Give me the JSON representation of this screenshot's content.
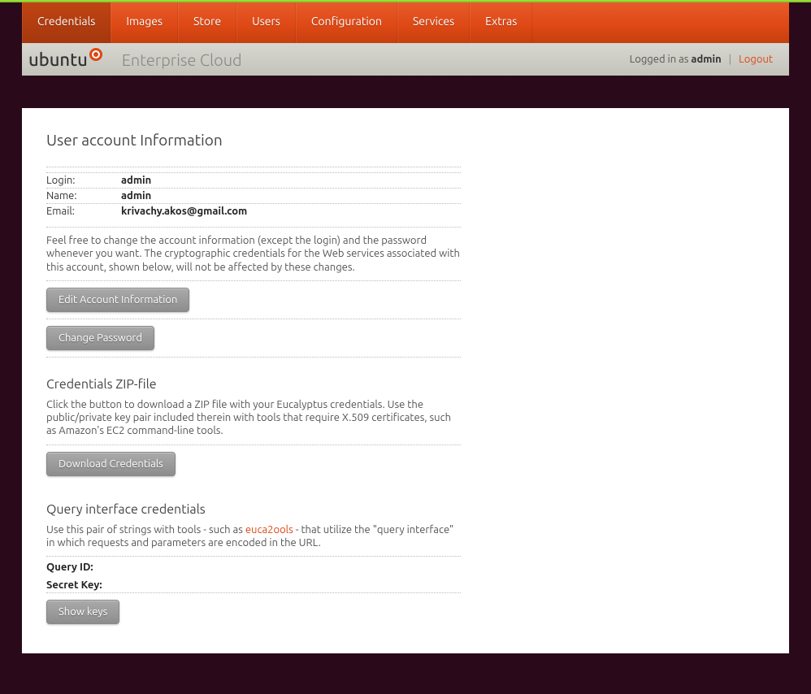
{
  "nav": {
    "items": [
      {
        "label": "Credentials",
        "active": true
      },
      {
        "label": "Images"
      },
      {
        "label": "Store"
      },
      {
        "label": "Users"
      },
      {
        "label": "Configuration"
      },
      {
        "label": "Services"
      },
      {
        "label": "Extras"
      }
    ]
  },
  "header": {
    "logo_text": "ubuntu",
    "subtitle": "Enterprise Cloud",
    "logged_in_prefix": "Logged in as ",
    "user": "admin",
    "logout": "Logout"
  },
  "account": {
    "title": "User account Information",
    "rows": {
      "login_label": "Login:",
      "login_value": "admin",
      "name_label": "Name:",
      "name_value": "admin",
      "email_label": "Email:",
      "email_value": "krivachy.akos@gmail.com"
    },
    "blurb": "Feel free to change the account information (except the login) and the password whenever you want. The cryptographic credentials for the Web services associated with this account, shown below, will not be affected by these changes.",
    "edit_btn": "Edit Account Information",
    "change_pw_btn": "Change Password"
  },
  "zip": {
    "title": "Credentials ZIP-file",
    "blurb": "Click the button to download a ZIP file with your Eucalyptus credentials. Use the public/private key pair included therein with tools that require X.509 certificates, such as Amazon's EC2 command-line tools.",
    "download_btn": "Download Credentials"
  },
  "query": {
    "title": "Query interface credentials",
    "blurb_before": "Use this pair of strings with tools - such as ",
    "blurb_link": "euca2ools",
    "blurb_after": " - that utilize the \"query interface\" in which requests and parameters are encoded in the URL.",
    "query_id_label": "Query ID:",
    "query_id_value": "",
    "secret_key_label": "Secret Key:",
    "secret_key_value": "",
    "show_btn": "Show keys"
  }
}
